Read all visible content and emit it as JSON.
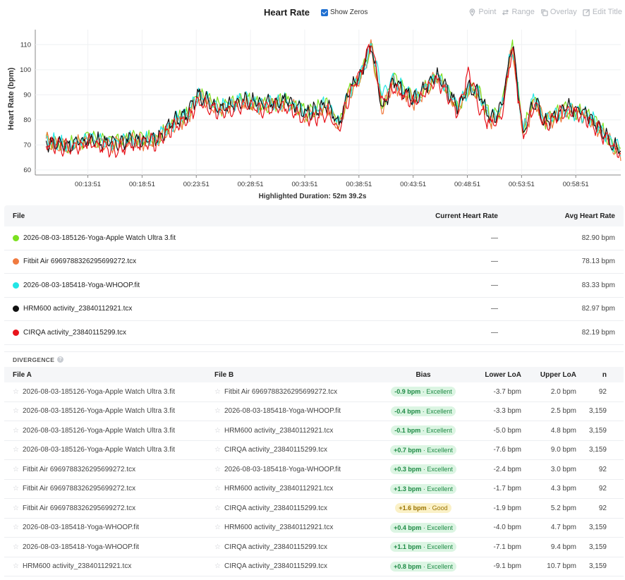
{
  "header": {
    "title": "Heart Rate",
    "show_zeros_label": "Show Zeros",
    "tools": [
      "Point",
      "Range",
      "Overlay",
      "Edit Title"
    ]
  },
  "chart_data": {
    "type": "line",
    "ylabel": "Heart Rate (bpm)",
    "xlabel": "",
    "ylim": [
      58,
      116
    ],
    "yticks": [
      60,
      70,
      80,
      90,
      100,
      110
    ],
    "xticks": [
      "00:13:51",
      "00:18:51",
      "00:23:51",
      "00:28:51",
      "00:33:51",
      "00:38:51",
      "00:43:51",
      "00:48:51",
      "00:53:51",
      "00:58:51"
    ],
    "grid": true,
    "x_minutes": [
      10.0,
      12.0,
      14.0,
      16.0,
      18.0,
      20.0,
      22.0,
      23.0,
      24.0,
      26.0,
      28.0,
      30.0,
      32.0,
      34.0,
      36.0,
      37.0,
      38.0,
      39.0,
      40.0,
      41.0,
      42.0,
      44.0,
      46.0,
      47.0,
      48.0,
      49.0,
      50.0,
      51.0,
      52.0,
      53.0,
      54.0,
      55.0,
      56.0,
      58.0,
      60.0,
      62.0,
      63.0
    ],
    "series": [
      {
        "name": "2026-08-03-185126-Yoga-Apple Watch Ultra 3.fit",
        "color": "#7be01f",
        "values": [
          72,
          70,
          73,
          71,
          73,
          72,
          80,
          82,
          90,
          85,
          88,
          86,
          88,
          83,
          86,
          78,
          92,
          98,
          110,
          85,
          96,
          88,
          98,
          92,
          85,
          93,
          90,
          80,
          85,
          110,
          75,
          88,
          80,
          84,
          82,
          72,
          68
        ]
      },
      {
        "name": "Fitbit Air 6969788326295699272.tcx",
        "color": "#f07a3f",
        "values": [
          72,
          69,
          72,
          70,
          72,
          71,
          79,
          81,
          89,
          84,
          87,
          85,
          87,
          82,
          85,
          77,
          91,
          97,
          109,
          84,
          95,
          87,
          97,
          91,
          84,
          92,
          89,
          79,
          84,
          109,
          74,
          87,
          79,
          83,
          81,
          71,
          67
        ]
      },
      {
        "name": "2026-08-03-185418-Yoga-WHOOP.fit",
        "color": "#22e5e5",
        "values": [
          72,
          70,
          73,
          71,
          73,
          72,
          80,
          82,
          90,
          85,
          88,
          86,
          88,
          83,
          86,
          78,
          92,
          98,
          110,
          90,
          96,
          88,
          98,
          92,
          85,
          93,
          90,
          80,
          85,
          110,
          75,
          90,
          80,
          84,
          82,
          72,
          68
        ]
      },
      {
        "name": "HRM600 activity_23840112921.tcx",
        "color": "#111111",
        "values": [
          71,
          70,
          72,
          71,
          72,
          72,
          80,
          82,
          90,
          84,
          88,
          86,
          88,
          83,
          86,
          78,
          92,
          98,
          110,
          84,
          96,
          88,
          98,
          92,
          84,
          93,
          90,
          80,
          85,
          111,
          74,
          88,
          79,
          85,
          82,
          72,
          67
        ]
      },
      {
        "name": "CIRQA activity_23840115299.tcx",
        "color": "#e8141c",
        "values": [
          70,
          69,
          71,
          68,
          70,
          71,
          78,
          80,
          87,
          83,
          85,
          84,
          86,
          80,
          83,
          76,
          90,
          99,
          111,
          86,
          93,
          86,
          96,
          90,
          83,
          100,
          85,
          78,
          82,
          109,
          73,
          86,
          78,
          84,
          80,
          71,
          66
        ]
      }
    ]
  },
  "duration": "Highlighted Duration: 52m 39.2s",
  "file_table": {
    "headers": [
      "File",
      "Current Heart Rate",
      "Avg Heart Rate"
    ],
    "rows": [
      {
        "name": "2026-08-03-185126-Yoga-Apple Watch Ultra 3.fit",
        "color": "#7be01f",
        "current": "—",
        "avg": "82.90 bpm"
      },
      {
        "name": "Fitbit Air 6969788326295699272.tcx",
        "color": "#f07a3f",
        "current": "—",
        "avg": "78.13 bpm"
      },
      {
        "name": "2026-08-03-185418-Yoga-WHOOP.fit",
        "color": "#22e5e5",
        "current": "—",
        "avg": "83.33 bpm"
      },
      {
        "name": "HRM600 activity_23840112921.tcx",
        "color": "#111111",
        "current": "—",
        "avg": "82.97 bpm"
      },
      {
        "name": "CIRQA activity_23840115299.tcx",
        "color": "#e8141c",
        "current": "—",
        "avg": "82.19 bpm"
      }
    ]
  },
  "divergence": {
    "title": "DIVERGENCE",
    "headers": [
      "File A",
      "File B",
      "Bias",
      "Lower LoA",
      "Upper LoA",
      "n"
    ],
    "rows": [
      {
        "a": "2026-08-03-185126-Yoga-Apple Watch Ultra 3.fit",
        "b": "Fitbit Air 6969788326295699272.tcx",
        "bias": "-0.9 bpm",
        "rating": "Excellent",
        "lo": "-3.7 bpm",
        "up": "2.0 bpm",
        "n": "92"
      },
      {
        "a": "2026-08-03-185126-Yoga-Apple Watch Ultra 3.fit",
        "b": "2026-08-03-185418-Yoga-WHOOP.fit",
        "bias": "-0.4 bpm",
        "rating": "Excellent",
        "lo": "-3.3 bpm",
        "up": "2.5 bpm",
        "n": "3,159"
      },
      {
        "a": "2026-08-03-185126-Yoga-Apple Watch Ultra 3.fit",
        "b": "HRM600 activity_23840112921.tcx",
        "bias": "-0.1 bpm",
        "rating": "Excellent",
        "lo": "-5.0 bpm",
        "up": "4.8 bpm",
        "n": "3,159"
      },
      {
        "a": "2026-08-03-185126-Yoga-Apple Watch Ultra 3.fit",
        "b": "CIRQA activity_23840115299.tcx",
        "bias": "+0.7 bpm",
        "rating": "Excellent",
        "lo": "-7.6 bpm",
        "up": "9.0 bpm",
        "n": "3,159"
      },
      {
        "a": "Fitbit Air 6969788326295699272.tcx",
        "b": "2026-08-03-185418-Yoga-WHOOP.fit",
        "bias": "+0.3 bpm",
        "rating": "Excellent",
        "lo": "-2.4 bpm",
        "up": "3.0 bpm",
        "n": "92"
      },
      {
        "a": "Fitbit Air 6969788326295699272.tcx",
        "b": "HRM600 activity_23840112921.tcx",
        "bias": "+1.3 bpm",
        "rating": "Excellent",
        "lo": "-1.7 bpm",
        "up": "4.3 bpm",
        "n": "92"
      },
      {
        "a": "Fitbit Air 6969788326295699272.tcx",
        "b": "CIRQA activity_23840115299.tcx",
        "bias": "+1.6 bpm",
        "rating": "Good",
        "lo": "-1.9 bpm",
        "up": "5.2 bpm",
        "n": "92"
      },
      {
        "a": "2026-08-03-185418-Yoga-WHOOP.fit",
        "b": "HRM600 activity_23840112921.tcx",
        "bias": "+0.4 bpm",
        "rating": "Excellent",
        "lo": "-4.0 bpm",
        "up": "4.7 bpm",
        "n": "3,159"
      },
      {
        "a": "2026-08-03-185418-Yoga-WHOOP.fit",
        "b": "CIRQA activity_23840115299.tcx",
        "bias": "+1.1 bpm",
        "rating": "Excellent",
        "lo": "-7.1 bpm",
        "up": "9.4 bpm",
        "n": "3,159"
      },
      {
        "a": "HRM600 activity_23840112921.tcx",
        "b": "CIRQA activity_23840115299.tcx",
        "bias": "+0.8 bpm",
        "rating": "Excellent",
        "lo": "-9.1 bpm",
        "up": "10.7 bpm",
        "n": "3,159"
      }
    ]
  }
}
